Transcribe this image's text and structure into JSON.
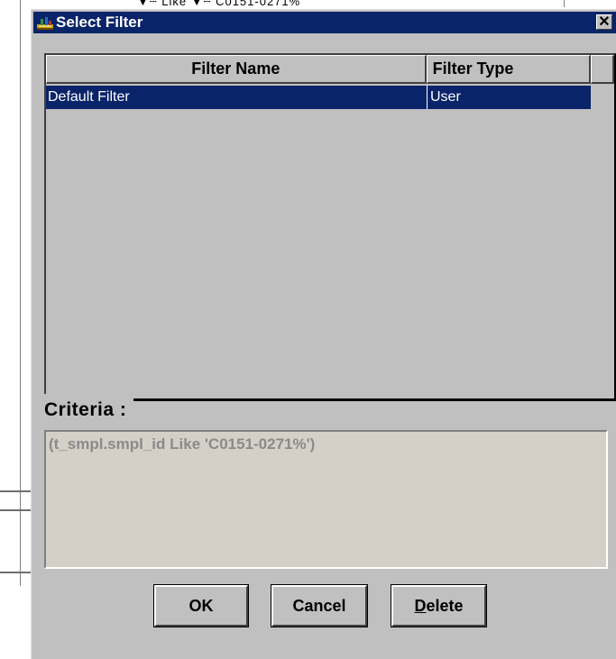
{
  "background": {
    "top_text": "▼┄ Like        ▼┄ C0151-0271%"
  },
  "dialog": {
    "title": "Select Filter",
    "close_glyph": "✕",
    "list": {
      "columns": [
        "Filter Name",
        "Filter Type"
      ],
      "rows": [
        {
          "name": "Default Filter",
          "type": "User",
          "selected": true
        }
      ]
    },
    "criteria_label": "Criteria :",
    "criteria_value": "(t_smpl.smpl_id Like 'C0151-0271%')",
    "buttons": {
      "ok": "OK",
      "cancel": "Cancel",
      "delete_first": "D",
      "delete_rest": "elete"
    }
  },
  "colors": {
    "titlebar": "#0a246a",
    "face": "#c0c0c0",
    "selection": "#0a246a",
    "criteria_text": "#8a8a8a"
  }
}
